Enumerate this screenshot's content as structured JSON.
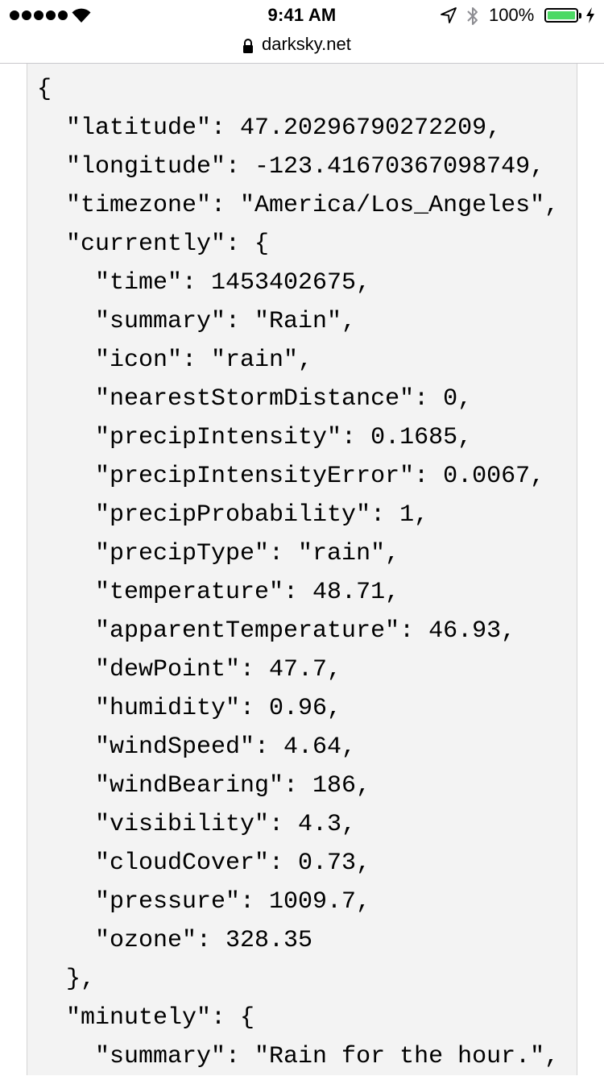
{
  "status_bar": {
    "time": "9:41 AM",
    "battery_percent": "100%",
    "battery_level": 1.0,
    "signal_bars": 5,
    "icons": [
      "signal-dots-icon",
      "wifi-icon",
      "location-arrow-icon",
      "bluetooth-icon",
      "battery-icon",
      "charging-bolt-icon"
    ]
  },
  "url_bar": {
    "url": "darksky.net",
    "icon": "lock-icon"
  },
  "code": {
    "lines": [
      "{",
      "  \"latitude\": 47.20296790272209,",
      "  \"longitude\": -123.41670367098749,",
      "  \"timezone\": \"America/Los_Angeles\",",
      "  \"currently\": {",
      "    \"time\": 1453402675,",
      "    \"summary\": \"Rain\",",
      "    \"icon\": \"rain\",",
      "    \"nearestStormDistance\": 0,",
      "    \"precipIntensity\": 0.1685,",
      "    \"precipIntensityError\": 0.0067,",
      "    \"precipProbability\": 1,",
      "    \"precipType\": \"rain\",",
      "    \"temperature\": 48.71,",
      "    \"apparentTemperature\": 46.93,",
      "    \"dewPoint\": 47.7,",
      "    \"humidity\": 0.96,",
      "    \"windSpeed\": 4.64,",
      "    \"windBearing\": 186,",
      "    \"visibility\": 4.3,",
      "    \"cloudCover\": 0.73,",
      "    \"pressure\": 1009.7,",
      "    \"ozone\": 328.35",
      "  },",
      "  \"minutely\": {",
      "    \"summary\": \"Rain for the hour.\","
    ]
  },
  "colors": {
    "background": "#ffffff",
    "code_background": "#f3f3f3",
    "battery_fill": "#4cd964"
  }
}
